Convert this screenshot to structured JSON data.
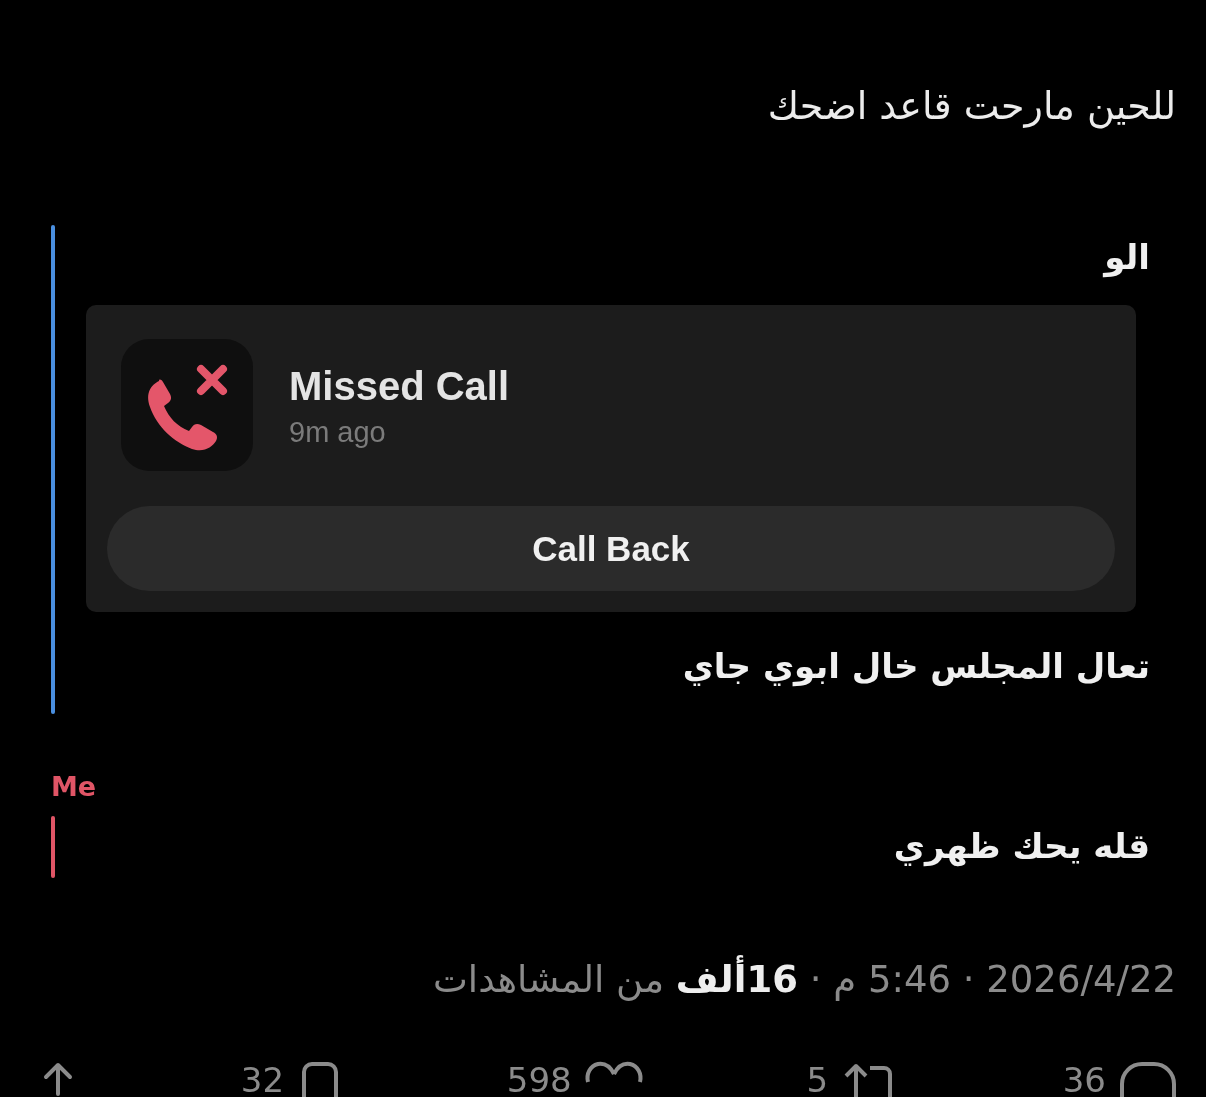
{
  "post_text": "للحين مارحت قاعد اضحك",
  "threads": [
    {
      "color": "#4a8fe0",
      "messages": [
        {
          "kind": "text",
          "text": "الو"
        },
        {
          "kind": "missed_call",
          "title": "Missed Call",
          "time": "9m ago",
          "action": "Call Back"
        },
        {
          "kind": "text",
          "text": "تعال المجلس خال ابوي جاي"
        }
      ]
    },
    {
      "sender": "Me",
      "color": "#e05566",
      "messages": [
        {
          "kind": "text",
          "text": "قله يحك ظهري"
        }
      ]
    }
  ],
  "meta": "2026/4/22 · 5:46 م · **16ألف** من المشاهدات",
  "actions": [
    {
      "kind": "reply",
      "count": "36"
    },
    {
      "kind": "repost",
      "count": "5"
    },
    {
      "kind": "like",
      "count": "598"
    },
    {
      "kind": "bookmark",
      "count": "32"
    },
    {
      "kind": "share"
    }
  ]
}
